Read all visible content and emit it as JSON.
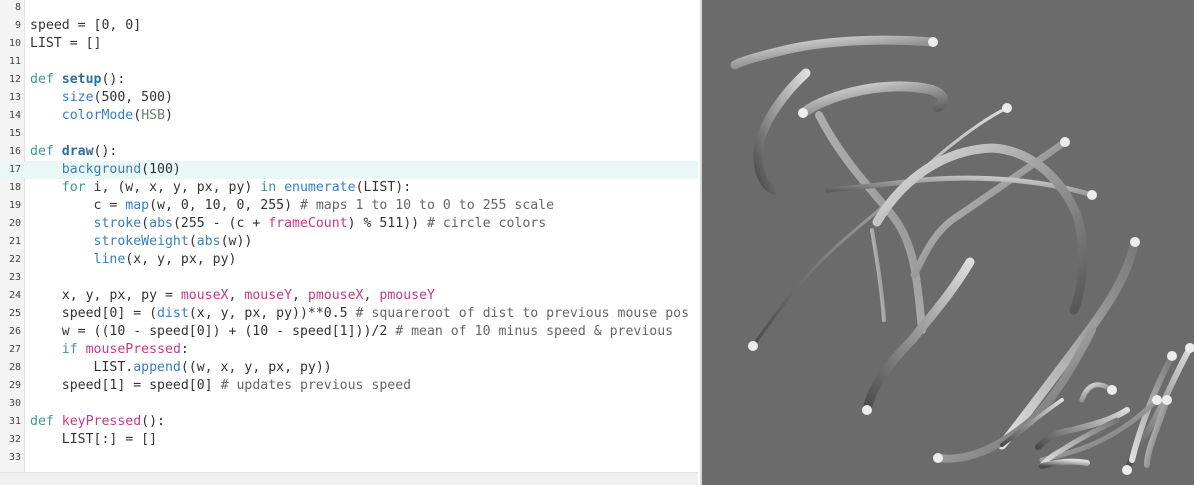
{
  "editor": {
    "active_line": 17,
    "lines": [
      {
        "n": "8",
        "tokens": []
      },
      {
        "n": "9",
        "tokens": [
          {
            "t": "speed = [0, 0]",
            "c": "pl"
          }
        ]
      },
      {
        "n": "10",
        "tokens": [
          {
            "t": "LIST = []",
            "c": "pl"
          }
        ]
      },
      {
        "n": "11",
        "tokens": []
      },
      {
        "n": "12",
        "tokens": [
          {
            "t": "def ",
            "c": "kw"
          },
          {
            "t": "setup",
            "c": "fn"
          },
          {
            "t": "():",
            "c": "pl"
          }
        ]
      },
      {
        "n": "13",
        "tokens": [
          {
            "t": "    ",
            "c": "pl"
          },
          {
            "t": "size",
            "c": "bi"
          },
          {
            "t": "(500, 500)",
            "c": "pl"
          }
        ]
      },
      {
        "n": "14",
        "tokens": [
          {
            "t": "    ",
            "c": "pl"
          },
          {
            "t": "colorMode",
            "c": "bi"
          },
          {
            "t": "(",
            "c": "pl"
          },
          {
            "t": "HSB",
            "c": "str"
          },
          {
            "t": ")",
            "c": "pl"
          }
        ]
      },
      {
        "n": "15",
        "tokens": []
      },
      {
        "n": "16",
        "tokens": [
          {
            "t": "def ",
            "c": "kw"
          },
          {
            "t": "draw",
            "c": "fn"
          },
          {
            "t": "():",
            "c": "pl"
          }
        ]
      },
      {
        "n": "17",
        "tokens": [
          {
            "t": "    ",
            "c": "pl"
          },
          {
            "t": "background",
            "c": "bi"
          },
          {
            "t": "(100)",
            "c": "pl"
          }
        ]
      },
      {
        "n": "18",
        "tokens": [
          {
            "t": "    ",
            "c": "pl"
          },
          {
            "t": "for",
            "c": "kw"
          },
          {
            "t": " i, (w, x, y, px, py) ",
            "c": "pl"
          },
          {
            "t": "in",
            "c": "kw"
          },
          {
            "t": " ",
            "c": "pl"
          },
          {
            "t": "enumerate",
            "c": "bi"
          },
          {
            "t": "(LIST):",
            "c": "pl"
          }
        ]
      },
      {
        "n": "19",
        "tokens": [
          {
            "t": "        c = ",
            "c": "pl"
          },
          {
            "t": "map",
            "c": "bi"
          },
          {
            "t": "(w, 0, 10, 0, 255) ",
            "c": "pl"
          },
          {
            "t": "# maps 1 to 10 to 0 to 255 scale",
            "c": "cm"
          }
        ]
      },
      {
        "n": "20",
        "tokens": [
          {
            "t": "        ",
            "c": "pl"
          },
          {
            "t": "stroke",
            "c": "bi"
          },
          {
            "t": "(",
            "c": "pl"
          },
          {
            "t": "abs",
            "c": "bi"
          },
          {
            "t": "(255 - (c + ",
            "c": "pl"
          },
          {
            "t": "frameCount",
            "c": "var"
          },
          {
            "t": ") % 511)) ",
            "c": "pl"
          },
          {
            "t": "# circle colors",
            "c": "cm"
          }
        ]
      },
      {
        "n": "21",
        "tokens": [
          {
            "t": "        ",
            "c": "pl"
          },
          {
            "t": "strokeWeight",
            "c": "bi"
          },
          {
            "t": "(",
            "c": "pl"
          },
          {
            "t": "abs",
            "c": "bi"
          },
          {
            "t": "(w))",
            "c": "pl"
          }
        ]
      },
      {
        "n": "22",
        "tokens": [
          {
            "t": "        ",
            "c": "pl"
          },
          {
            "t": "line",
            "c": "bi"
          },
          {
            "t": "(x, y, px, py)",
            "c": "pl"
          }
        ]
      },
      {
        "n": "23",
        "tokens": []
      },
      {
        "n": "24",
        "tokens": [
          {
            "t": "    x, y, px, py = ",
            "c": "pl"
          },
          {
            "t": "mouseX",
            "c": "var"
          },
          {
            "t": ", ",
            "c": "pl"
          },
          {
            "t": "mouseY",
            "c": "var"
          },
          {
            "t": ", ",
            "c": "pl"
          },
          {
            "t": "pmouseX",
            "c": "var"
          },
          {
            "t": ", ",
            "c": "pl"
          },
          {
            "t": "pmouseY",
            "c": "var"
          }
        ]
      },
      {
        "n": "25",
        "tokens": [
          {
            "t": "    speed[0] = (",
            "c": "pl"
          },
          {
            "t": "dist",
            "c": "bi"
          },
          {
            "t": "(x, y, px, py))**0.5 ",
            "c": "pl"
          },
          {
            "t": "# squareroot of dist to previous mouse pos",
            "c": "cm"
          }
        ]
      },
      {
        "n": "26",
        "tokens": [
          {
            "t": "    w = ((10 - speed[0]) + (10 - speed[1]))/2 ",
            "c": "pl"
          },
          {
            "t": "# mean of 10 minus speed & previous",
            "c": "cm"
          }
        ]
      },
      {
        "n": "27",
        "tokens": [
          {
            "t": "    ",
            "c": "pl"
          },
          {
            "t": "if",
            "c": "kw"
          },
          {
            "t": " ",
            "c": "pl"
          },
          {
            "t": "mousePressed",
            "c": "var"
          },
          {
            "t": ":",
            "c": "pl"
          }
        ]
      },
      {
        "n": "28",
        "tokens": [
          {
            "t": "        LIST.",
            "c": "pl"
          },
          {
            "t": "append",
            "c": "bi"
          },
          {
            "t": "((w, x, y, px, py))",
            "c": "pl"
          }
        ]
      },
      {
        "n": "29",
        "tokens": [
          {
            "t": "    speed[1] = speed[0] ",
            "c": "pl"
          },
          {
            "t": "# updates previous speed",
            "c": "cm"
          }
        ]
      },
      {
        "n": "30",
        "tokens": []
      },
      {
        "n": "31",
        "tokens": [
          {
            "t": "def ",
            "c": "kw"
          },
          {
            "t": "keyPressed",
            "c": "var"
          },
          {
            "t": "():",
            "c": "pl"
          }
        ]
      },
      {
        "n": "32",
        "tokens": [
          {
            "t": "    LIST[:] = []",
            "c": "pl"
          }
        ]
      },
      {
        "n": "33",
        "tokens": []
      }
    ]
  },
  "sketch": {
    "background": "#6b6b6b",
    "stroke_gradient": [
      "#dcdcdc",
      "#9a9a9a",
      "#4a4a4a"
    ]
  }
}
